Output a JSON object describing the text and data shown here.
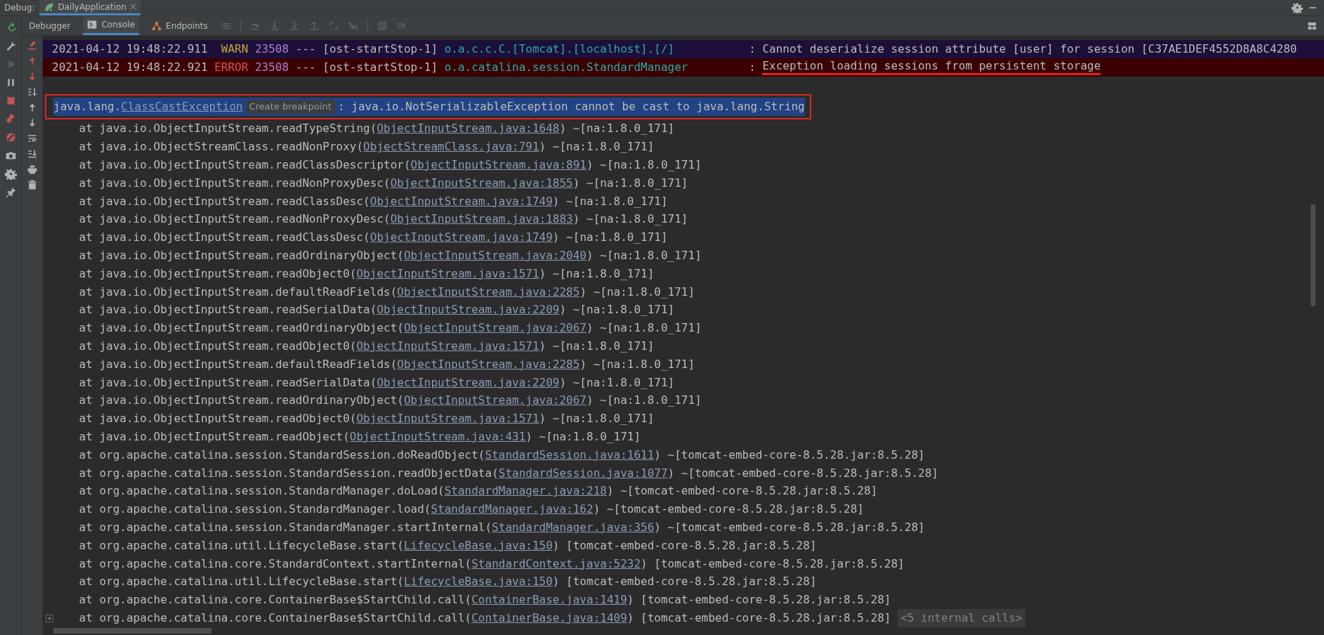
{
  "window": {
    "label": "Debug:",
    "tabs": [
      {
        "label": "DailyApplication",
        "selected": true
      }
    ]
  },
  "panel_tabs": [
    {
      "label": "Debugger",
      "selected": false
    },
    {
      "label": "Console",
      "selected": true
    },
    {
      "label": "Endpoints",
      "selected": false
    }
  ],
  "log_lines": [
    {
      "kind": "warn",
      "timestamp": "2021-04-12 19:48:22.911",
      "level": "WARN",
      "pid": "23508",
      "dashes": "---",
      "thread": "[ost-startStop-1]",
      "logger": "o.a.c.c.C.[Tomcat].[localhost].[/]",
      "colon": ":",
      "message": "Cannot deserialize session attribute [user] for session [C37AE1DEF4552D8A8C4280",
      "annotated": false
    },
    {
      "kind": "error",
      "timestamp": "2021-04-12 19:48:22.921",
      "level": "ERROR",
      "pid": "23508",
      "dashes": "---",
      "thread": "[ost-startStop-1]",
      "logger": "o.a.catalina.session.StandardManager",
      "colon": ":",
      "message": "Exception loading sessions from persistent storage",
      "annotated": true
    }
  ],
  "exception": {
    "package": "java.lang.",
    "link": "ClassCastException",
    "hint": "Create breakpoint",
    "message": ": java.io.NotSerializableException cannot be cast to java.lang.String",
    "selected": true,
    "outlined": true
  },
  "frames": [
    {
      "prefix": "at java.io.ObjectInputStream.readTypeString(",
      "link": "ObjectInputStream.java:1648",
      "suffix": ") ~[na:1.8.0_171]"
    },
    {
      "prefix": "at java.io.ObjectStreamClass.readNonProxy(",
      "link": "ObjectStreamClass.java:791",
      "suffix": ") ~[na:1.8.0_171]"
    },
    {
      "prefix": "at java.io.ObjectInputStream.readClassDescriptor(",
      "link": "ObjectInputStream.java:891",
      "suffix": ") ~[na:1.8.0_171]"
    },
    {
      "prefix": "at java.io.ObjectInputStream.readNonProxyDesc(",
      "link": "ObjectInputStream.java:1855",
      "suffix": ") ~[na:1.8.0_171]"
    },
    {
      "prefix": "at java.io.ObjectInputStream.readClassDesc(",
      "link": "ObjectInputStream.java:1749",
      "suffix": ") ~[na:1.8.0_171]"
    },
    {
      "prefix": "at java.io.ObjectInputStream.readNonProxyDesc(",
      "link": "ObjectInputStream.java:1883",
      "suffix": ") ~[na:1.8.0_171]"
    },
    {
      "prefix": "at java.io.ObjectInputStream.readClassDesc(",
      "link": "ObjectInputStream.java:1749",
      "suffix": ") ~[na:1.8.0_171]"
    },
    {
      "prefix": "at java.io.ObjectInputStream.readOrdinaryObject(",
      "link": "ObjectInputStream.java:2040",
      "suffix": ") ~[na:1.8.0_171]"
    },
    {
      "prefix": "at java.io.ObjectInputStream.readObject0(",
      "link": "ObjectInputStream.java:1571",
      "suffix": ") ~[na:1.8.0_171]"
    },
    {
      "prefix": "at java.io.ObjectInputStream.defaultReadFields(",
      "link": "ObjectInputStream.java:2285",
      "suffix": ") ~[na:1.8.0_171]"
    },
    {
      "prefix": "at java.io.ObjectInputStream.readSerialData(",
      "link": "ObjectInputStream.java:2209",
      "suffix": ") ~[na:1.8.0_171]"
    },
    {
      "prefix": "at java.io.ObjectInputStream.readOrdinaryObject(",
      "link": "ObjectInputStream.java:2067",
      "suffix": ") ~[na:1.8.0_171]"
    },
    {
      "prefix": "at java.io.ObjectInputStream.readObject0(",
      "link": "ObjectInputStream.java:1571",
      "suffix": ") ~[na:1.8.0_171]"
    },
    {
      "prefix": "at java.io.ObjectInputStream.defaultReadFields(",
      "link": "ObjectInputStream.java:2285",
      "suffix": ") ~[na:1.8.0_171]"
    },
    {
      "prefix": "at java.io.ObjectInputStream.readSerialData(",
      "link": "ObjectInputStream.java:2209",
      "suffix": ") ~[na:1.8.0_171]"
    },
    {
      "prefix": "at java.io.ObjectInputStream.readOrdinaryObject(",
      "link": "ObjectInputStream.java:2067",
      "suffix": ") ~[na:1.8.0_171]"
    },
    {
      "prefix": "at java.io.ObjectInputStream.readObject0(",
      "link": "ObjectInputStream.java:1571",
      "suffix": ") ~[na:1.8.0_171]"
    },
    {
      "prefix": "at java.io.ObjectInputStream.readObject(",
      "link": "ObjectInputStream.java:431",
      "suffix": ") ~[na:1.8.0_171]"
    },
    {
      "prefix": "at org.apache.catalina.session.StandardSession.doReadObject(",
      "link": "StandardSession.java:1611",
      "suffix": ") ~[tomcat-embed-core-8.5.28.jar:8.5.28]"
    },
    {
      "prefix": "at org.apache.catalina.session.StandardSession.readObjectData(",
      "link": "StandardSession.java:1077",
      "suffix": ") ~[tomcat-embed-core-8.5.28.jar:8.5.28]"
    },
    {
      "prefix": "at org.apache.catalina.session.StandardManager.doLoad(",
      "link": "StandardManager.java:218",
      "suffix": ") ~[tomcat-embed-core-8.5.28.jar:8.5.28]"
    },
    {
      "prefix": "at org.apache.catalina.session.StandardManager.load(",
      "link": "StandardManager.java:162",
      "suffix": ") ~[tomcat-embed-core-8.5.28.jar:8.5.28]"
    },
    {
      "prefix": "at org.apache.catalina.session.StandardManager.startInternal(",
      "link": "StandardManager.java:356",
      "suffix": ") ~[tomcat-embed-core-8.5.28.jar:8.5.28]"
    },
    {
      "prefix": "at org.apache.catalina.util.LifecycleBase.start(",
      "link": "LifecycleBase.java:150",
      "suffix": ") [tomcat-embed-core-8.5.28.jar:8.5.28]"
    },
    {
      "prefix": "at org.apache.catalina.core.StandardContext.startInternal(",
      "link": "StandardContext.java:5232",
      "suffix": ") [tomcat-embed-core-8.5.28.jar:8.5.28]"
    },
    {
      "prefix": "at org.apache.catalina.util.LifecycleBase.start(",
      "link": "LifecycleBase.java:150",
      "suffix": ") [tomcat-embed-core-8.5.28.jar:8.5.28]"
    },
    {
      "prefix": "at org.apache.catalina.core.ContainerBase$StartChild.call(",
      "link": "ContainerBase.java:1419",
      "suffix": ") [tomcat-embed-core-8.5.28.jar:8.5.28]"
    },
    {
      "prefix": "at org.apache.catalina.core.ContainerBase$StartChild.call(",
      "link": "ContainerBase.java:1409",
      "suffix": ") [tomcat-embed-core-8.5.28.jar:8.5.28]",
      "folded": "<5 internal calls>",
      "expandable": true
    }
  ]
}
